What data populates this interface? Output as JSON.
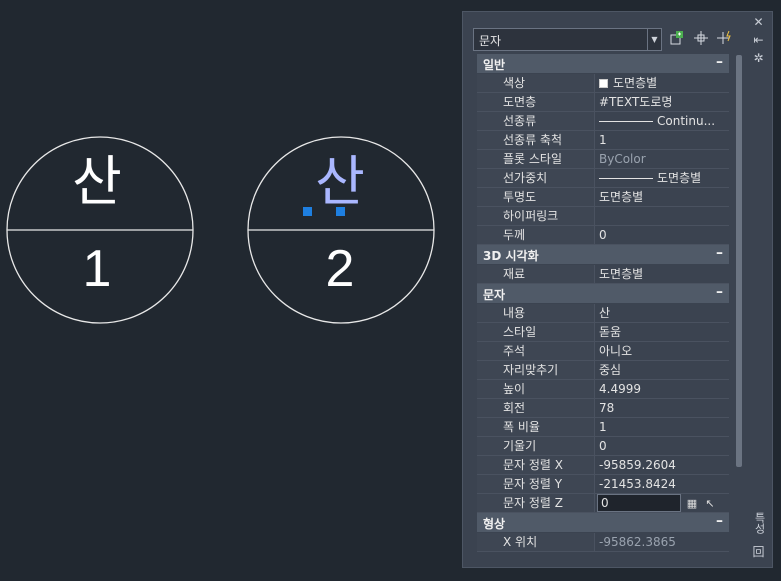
{
  "drawing": {
    "circle1": {
      "top_text": "산",
      "bottom_text": "1"
    },
    "circle2": {
      "top_text": "산",
      "bottom_text": "2"
    }
  },
  "palette": {
    "selection_combo": "문자",
    "side_buttons": {
      "close": "✕",
      "autohide": "⇤",
      "properties_menu": "✲",
      "bottom": "回"
    },
    "vertical_title": "특성",
    "sections": {
      "general": {
        "title": "일반",
        "rows": [
          {
            "label": "색상",
            "value": "도면층별"
          },
          {
            "label": "도면층",
            "value": "#TEXT도로명"
          },
          {
            "label": "선종류",
            "value": "Continu..."
          },
          {
            "label": "선종류 축척",
            "value": "1"
          },
          {
            "label": "플롯 스타일",
            "value": "ByColor"
          },
          {
            "label": "선가중치",
            "value": "도면층별"
          },
          {
            "label": "투명도",
            "value": "도면층별"
          },
          {
            "label": "하이퍼링크",
            "value": ""
          },
          {
            "label": "두께",
            "value": "0"
          }
        ]
      },
      "visual3d": {
        "title": "3D 시각화",
        "rows": [
          {
            "label": "재료",
            "value": "도면층별"
          }
        ]
      },
      "text": {
        "title": "문자",
        "rows": [
          {
            "label": "내용",
            "value": "산"
          },
          {
            "label": "스타일",
            "value": "돋움"
          },
          {
            "label": "주석",
            "value": "아니오"
          },
          {
            "label": "자리맞추기",
            "value": "중심"
          },
          {
            "label": "높이",
            "value": "4.4999"
          },
          {
            "label": "회전",
            "value": "78"
          },
          {
            "label": "폭 비율",
            "value": "1"
          },
          {
            "label": "기울기",
            "value": "0"
          },
          {
            "label": "문자 정렬 X",
            "value": "-95859.2604"
          },
          {
            "label": "문자 정렬 Y",
            "value": "-21453.8424"
          },
          {
            "label": "문자 정렬 Z",
            "value": "0"
          }
        ]
      },
      "geometry": {
        "title": "형상",
        "rows": [
          {
            "label": "X 위치",
            "value": "-95862.3865"
          }
        ]
      }
    },
    "collapse_glyph": "–",
    "colors": {
      "accent_grip": "#1e7fe0",
      "selected_text": "#aab7ff"
    }
  }
}
